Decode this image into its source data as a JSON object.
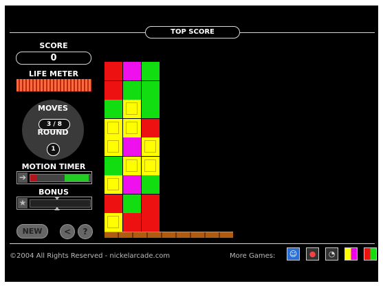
{
  "header": {
    "top_score_label": "TOP SCORE"
  },
  "sidebar": {
    "score_label": "SCORE",
    "score_value": "0",
    "life_label": "LIFE METER",
    "moves_label": "MOVES",
    "moves_value": "3 / 8",
    "round_label": "ROUND",
    "round_value": "1",
    "timer_label": "MOTION TIMER",
    "timer_red_fraction": 0.1,
    "timer_green_fraction": 0.4,
    "bonus_label": "BONUS",
    "new_button": "NEW",
    "back_button": "<",
    "help_button": "?"
  },
  "board": {
    "columns": 3,
    "rows": [
      [
        "red",
        "magenta",
        "green"
      ],
      [
        "red",
        "green",
        "green"
      ],
      [
        "green",
        "yellow",
        "green"
      ],
      [
        "yellow",
        "yellow",
        "red"
      ],
      [
        "yellow",
        "magenta",
        "yellow"
      ],
      [
        "green",
        "yellow",
        "yellow"
      ],
      [
        "yellow",
        "magenta",
        "green"
      ],
      [
        "red",
        "green",
        "red"
      ],
      [
        "yellow",
        "red",
        "red"
      ]
    ],
    "colors": {
      "red": "#ee1111",
      "magenta": "#ee11ee",
      "green": "#11dd11",
      "yellow": "#ffff00"
    }
  },
  "footer": {
    "copyright": "©2004 All Rights Reserved - nickelarcade.com",
    "more_games_label": "More Games:",
    "game_icons": [
      "face-icon",
      "balls-icon",
      "mouse-icon",
      "blocks-icon",
      "squares-icon"
    ]
  }
}
